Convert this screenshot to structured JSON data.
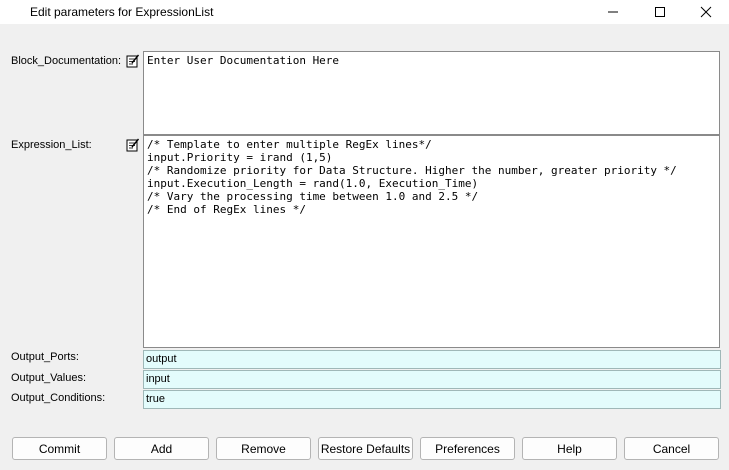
{
  "window": {
    "title": "Edit parameters for ExpressionList",
    "controls": {
      "minimize_icon": "minimize-icon",
      "maximize_icon": "maximize-icon",
      "close_icon": "close-icon"
    }
  },
  "params": {
    "block_documentation": {
      "label": "Block_Documentation:",
      "value": "Enter User Documentation Here"
    },
    "expression_list": {
      "label": "Expression_List:",
      "value": "/* Template to enter multiple RegEx lines*/\ninput.Priority = irand (1,5)\n/* Randomize priority for Data Structure. Higher the number, greater priority */\ninput.Execution_Length = rand(1.0, Execution_Time)\n/* Vary the processing time between 1.0 and 2.5 */\n/* End of RegEx lines */"
    },
    "output_ports": {
      "label": "Output_Ports:",
      "value": "output"
    },
    "output_values": {
      "label": "Output_Values:",
      "value": "input"
    },
    "output_conditions": {
      "label": "Output_Conditions:",
      "value": "true"
    }
  },
  "buttons": {
    "commit": "Commit",
    "add": "Add",
    "remove": "Remove",
    "restore_defaults": "Restore Defaults",
    "preferences": "Preferences",
    "help": "Help",
    "cancel": "Cancel"
  },
  "colors": {
    "field_background": "#e3fcfc",
    "dialog_background": "#f0f0f0"
  }
}
